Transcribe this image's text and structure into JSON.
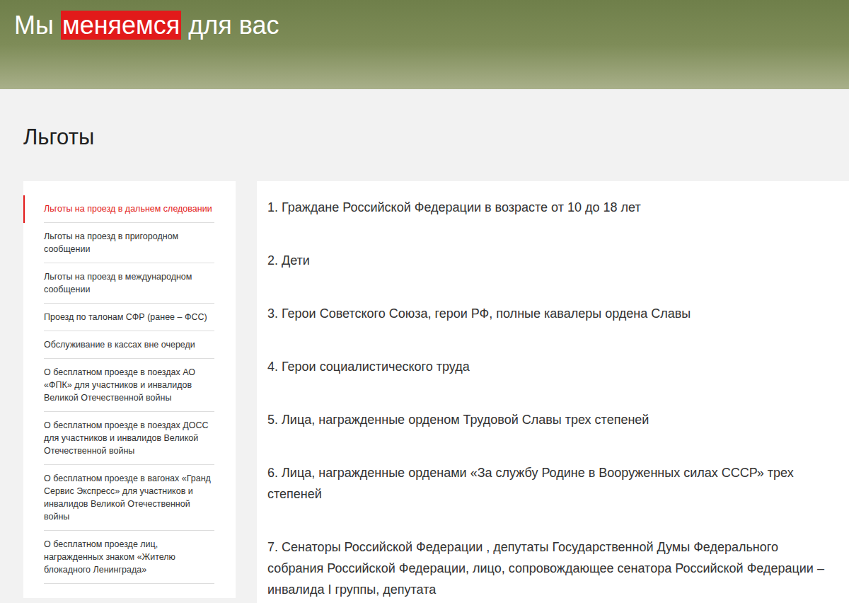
{
  "header": {
    "title_parts": [
      {
        "text": "Мы ",
        "highlighted": false
      },
      {
        "text": "меняемся",
        "highlighted": true
      },
      {
        "text": " для вас",
        "highlighted": false
      }
    ]
  },
  "page_title": "Льготы",
  "sidebar": {
    "items": [
      {
        "label": "Льготы на проезд в дальнем следовании",
        "selected": true
      },
      {
        "label": "Льготы на проезд в пригородном сообщении",
        "selected": false
      },
      {
        "label": "Льготы на проезд в международном сообщении",
        "selected": false
      },
      {
        "label": "Проезд по талонам СФР (ранее – ФСС)",
        "selected": false
      },
      {
        "label": "Обслуживание в кассах вне очереди",
        "selected": false
      },
      {
        "label": "О бесплатном проезде в поездах АО «ФПК» для участников и инвалидов Великой Отечественной войны",
        "selected": false
      },
      {
        "label": "О бесплатном проезде в поездах ДОСС для участников и инвалидов Великой Отечественной войны",
        "selected": false
      },
      {
        "label": "О бесплатном проезде в вагонах «Гранд Сервис Экспресс» для участников и инвалидов Великой Отечественной войны",
        "selected": false
      },
      {
        "label": "О бесплатном проезде лиц, награжденных знаком «Жителю блокадного Ленинграда»",
        "selected": false
      }
    ]
  },
  "content": {
    "items": [
      "1. Граждане Российской Федерации в возрасте от 10 до 18 лет",
      "2. Дети",
      "3. Герои Советского Союза, герои РФ, полные кавалеры ордена Славы",
      "4. Герои социалистического труда",
      "5. Лица, награжденные орденом Трудовой Славы трех степеней",
      "6. Лица, награжденные орденами «За службу Родине в Вооруженных силах СССР» трех степеней",
      "7. Сенаторы Российской Федерации , депутаты Государственной Думы Федерального собрания Российской Федерации, лицо, сопровождающее сенатора Российской Федерации – инвалида I группы, депутата"
    ]
  }
}
